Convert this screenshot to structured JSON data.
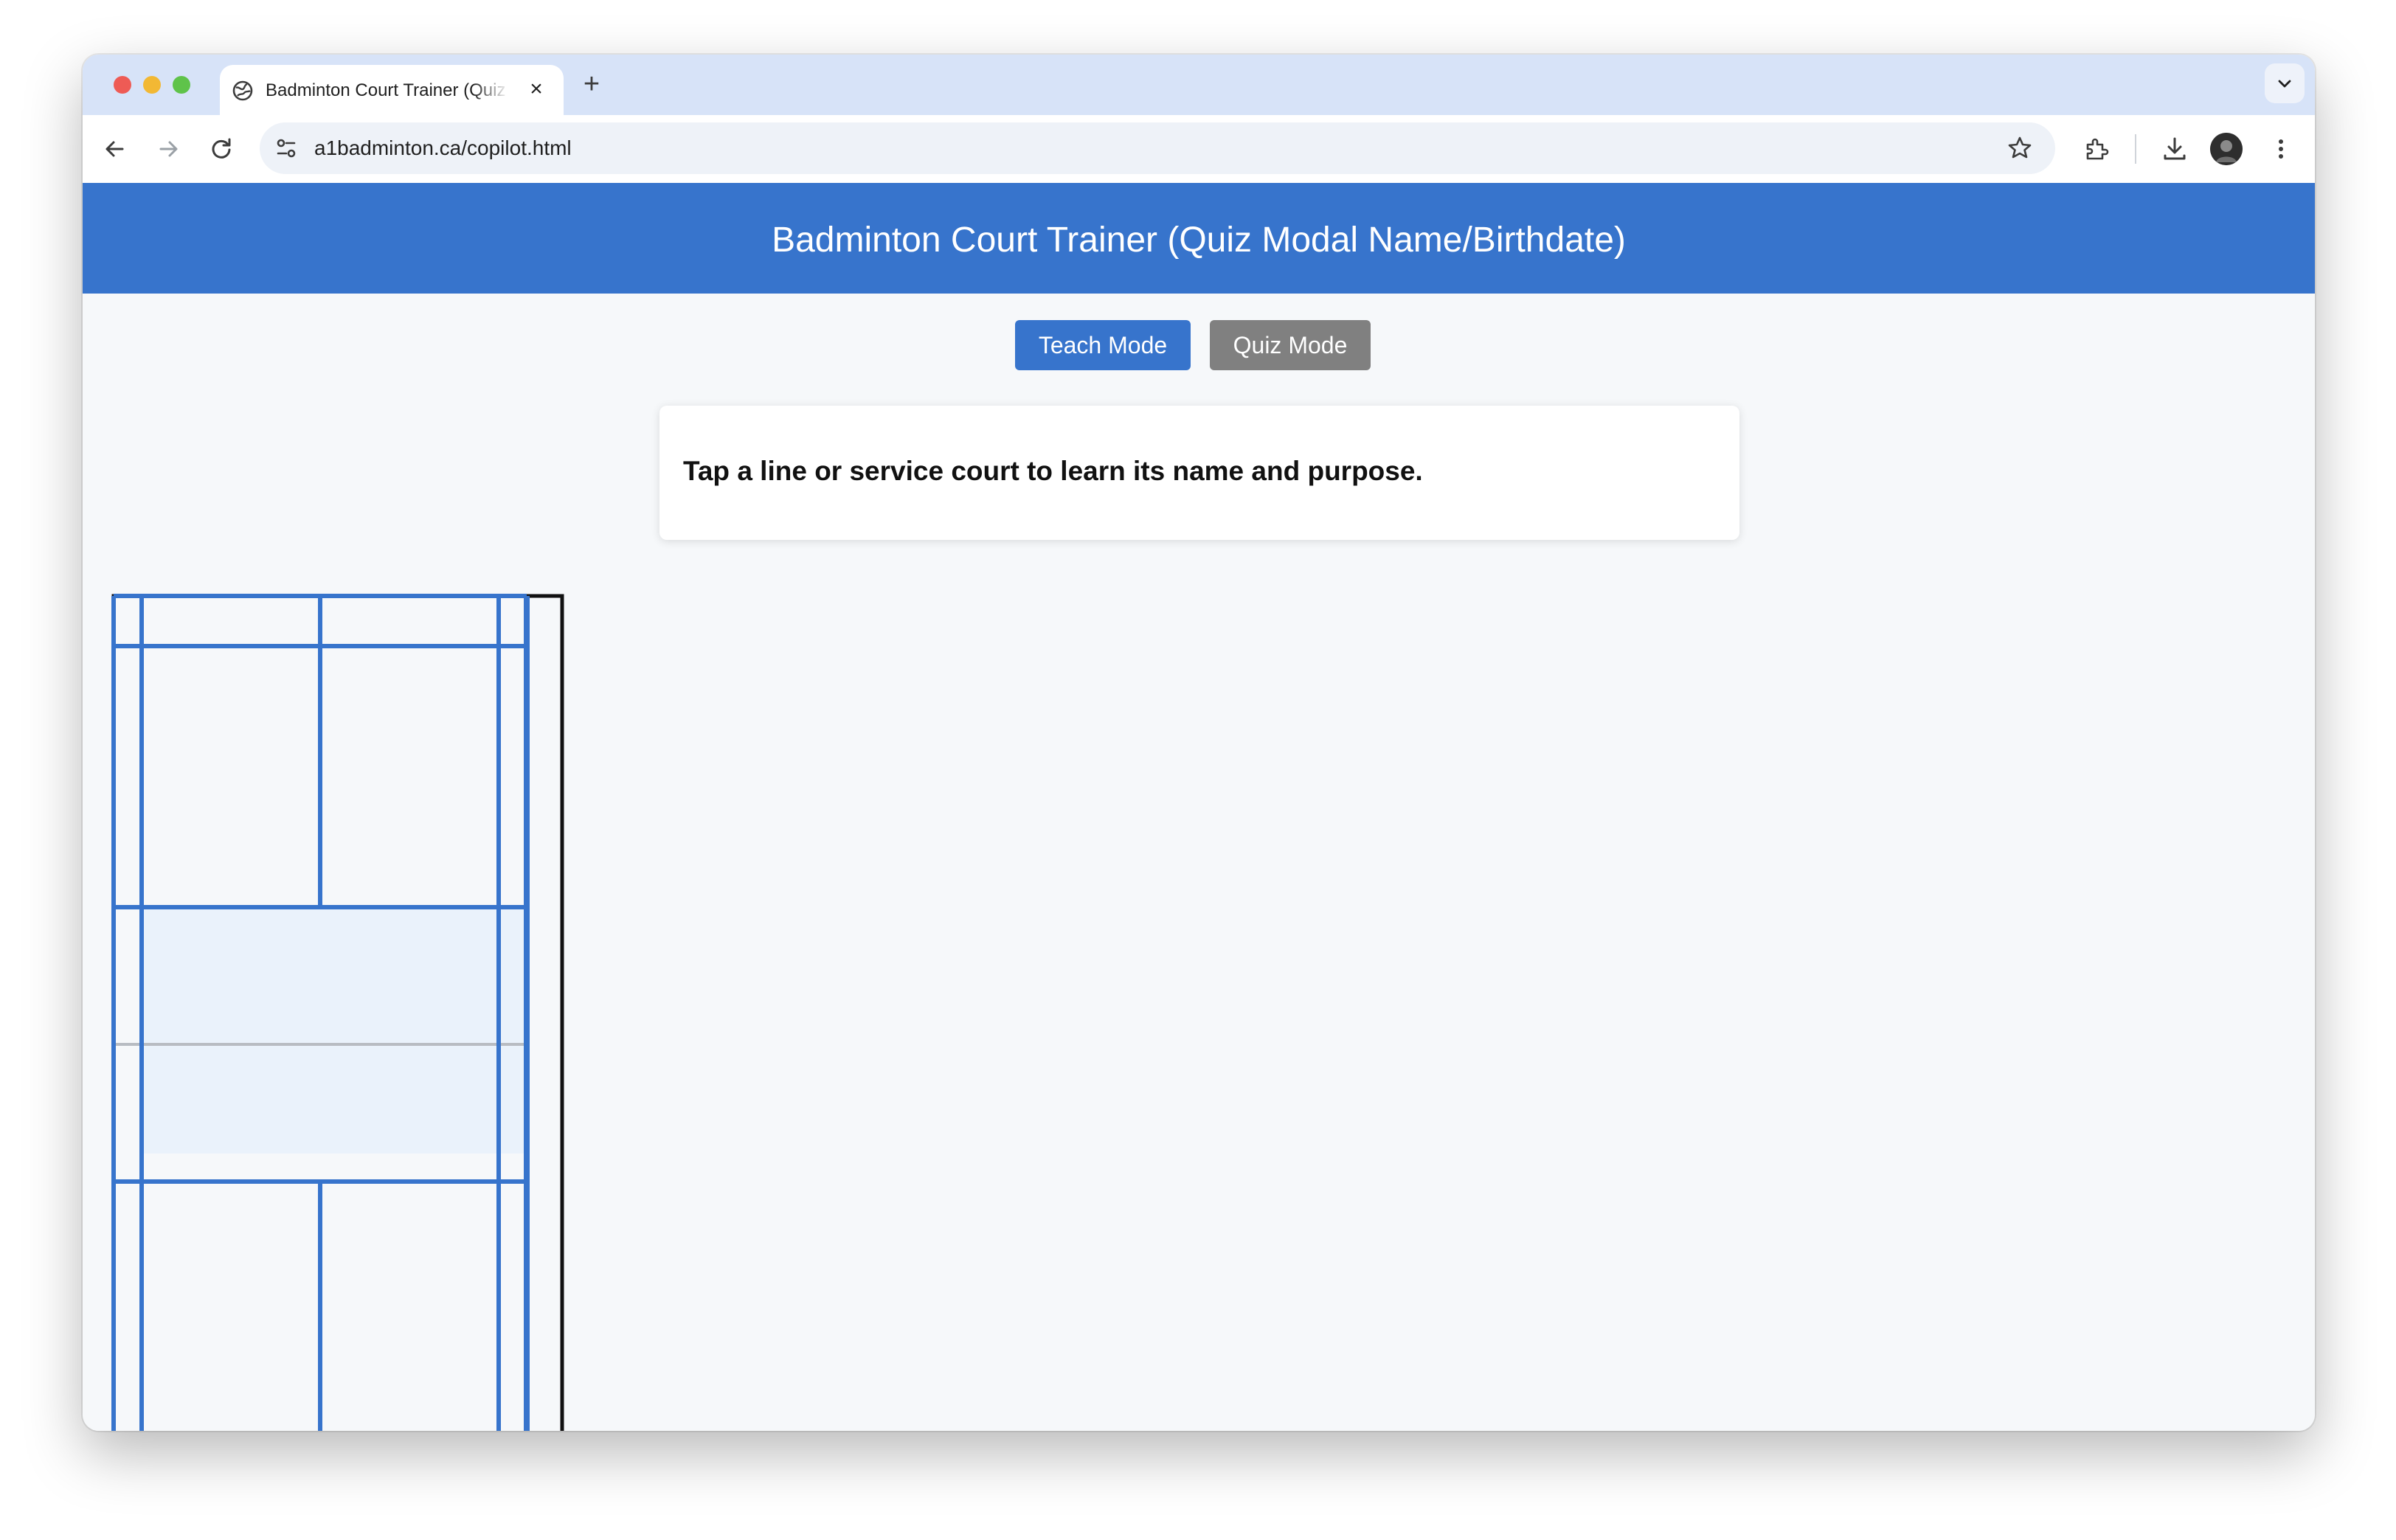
{
  "browser": {
    "tab_title": "Badminton Court Trainer (Quiz Modal Name/Birthdate)",
    "new_tab_label": "+",
    "close_label": "×",
    "url": "a1badminton.ca/copilot.html"
  },
  "app": {
    "title": "Badminton Court Trainer (Quiz Modal Name/Birthdate)",
    "modes": {
      "teach_label": "Teach Mode",
      "quiz_label": "Quiz Mode"
    },
    "info_text": "Tap a line or service court to learn its name and purpose."
  },
  "colors": {
    "brand_blue": "#3774cc",
    "inactive_gray": "#808080",
    "court_line": "#3774cc",
    "net": "#b8bcc2",
    "highlight": "#eaf2fb"
  },
  "icons": [
    "globe-icon",
    "close-icon",
    "plus-icon",
    "chevron-down-icon",
    "back-icon",
    "forward-icon",
    "reload-icon",
    "tune-icon",
    "star-icon",
    "extensions-icon",
    "download-icon",
    "avatar",
    "more-vert-icon"
  ]
}
